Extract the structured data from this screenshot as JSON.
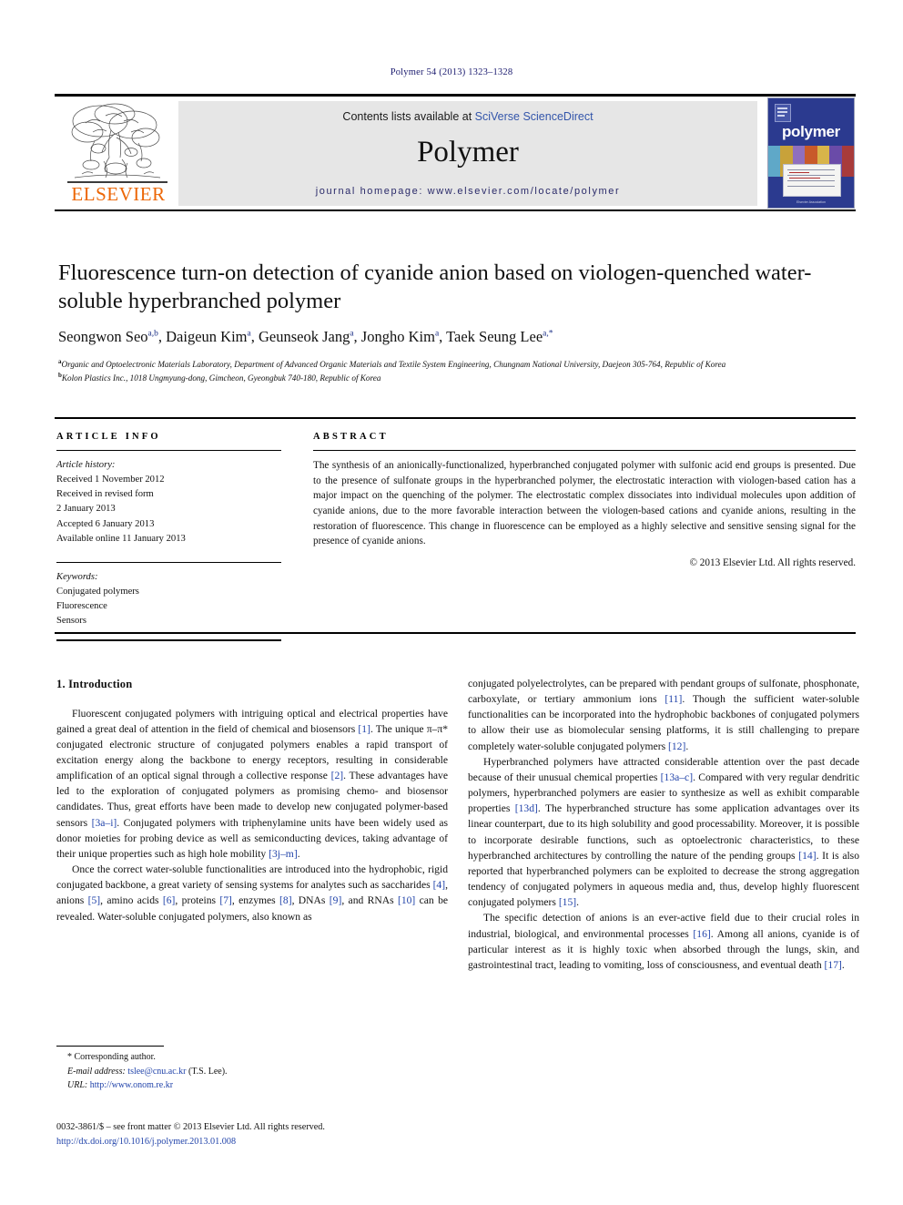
{
  "running_head": "Polymer 54 (2013) 1323–1328",
  "masthead": {
    "contents_prefix": "Contents lists available at ",
    "contents_link": "SciVerse ScienceDirect",
    "journal_name": "Polymer",
    "homepage": "journal homepage: www.elsevier.com/locate/polymer",
    "publisher_logo_text": "ELSEVIER",
    "cover_title": "polymer",
    "cover_footer": "Elsevier Association"
  },
  "article": {
    "title": "Fluorescence turn-on detection of cyanide anion based on viologen-quenched water-soluble hyperbranched polymer",
    "authors_html": "Seongwon Seo<sup>a,b</sup>, Daigeun Kim<sup>a</sup>, Geunseok Jang<sup>a</sup>, Jongho Kim<sup>a</sup>, Taek Seung Lee<sup>a,*</sup>",
    "affiliation_a": "Organic and Optoelectronic Materials Laboratory, Department of Advanced Organic Materials and Textile System Engineering, Chungnam National University, Daejeon 305-764, Republic of Korea",
    "affiliation_b": "Kolon Plastics Inc., 1018 Ungmyung-dong, Gimcheon, Gyeongbuk 740-180, Republic of Korea"
  },
  "article_info": {
    "heading": "ARTICLE INFO",
    "history_label": "Article history:",
    "history": [
      "Received 1 November 2012",
      "Received in revised form",
      "2 January 2013",
      "Accepted 6 January 2013",
      "Available online 11 January 2013"
    ],
    "keywords_label": "Keywords:",
    "keywords": [
      "Conjugated polymers",
      "Fluorescence",
      "Sensors"
    ]
  },
  "abstract": {
    "heading": "ABSTRACT",
    "text": "The synthesis of an anionically-functionalized, hyperbranched conjugated polymer with sulfonic acid end groups is presented. Due to the presence of sulfonate groups in the hyperbranched polymer, the electrostatic interaction with viologen-based cation has a major impact on the quenching of the polymer. The electrostatic complex dissociates into individual molecules upon addition of cyanide anions, due to the more favorable interaction between the viologen-based cations and cyanide anions, resulting in the restoration of fluorescence. This change in fluorescence can be employed as a highly selective and sensitive sensing signal for the presence of cyanide anions.",
    "copyright": "© 2013 Elsevier Ltd. All rights reserved."
  },
  "body": {
    "section_heading": "1. Introduction",
    "left_paragraphs_html": [
      "Fluorescent conjugated polymers with intriguing optical and electrical properties have gained a great deal of attention in the field of chemical and biosensors <span class=\"ref\">[1]</span>. The unique π&ndash;π* conjugated electronic structure of conjugated polymers enables a rapid transport of excitation energy along the backbone to energy receptors, resulting in considerable amplification of an optical signal through a collective response <span class=\"ref\">[2]</span>. These advantages have led to the exploration of conjugated polymers as promising chemo- and biosensor candidates. Thus, great efforts have been made to develop new conjugated polymer-based sensors <span class=\"ref\">[3a&ndash;i]</span>. Conjugated polymers with triphenylamine units have been widely used as donor moieties for probing device as well as semiconducting devices, taking advantage of their unique properties such as high hole mobility <span class=\"ref\">[3j&ndash;m]</span>.",
      "Once the correct water-soluble functionalities are introduced into the hydrophobic, rigid conjugated backbone, a great variety of sensing systems for analytes such as saccharides <span class=\"ref\">[4]</span>, anions <span class=\"ref\">[5]</span>, amino acids <span class=\"ref\">[6]</span>, proteins <span class=\"ref\">[7]</span>, enzymes <span class=\"ref\">[8]</span>, DNAs <span class=\"ref\">[9]</span>, and RNAs <span class=\"ref\">[10]</span> can be revealed. Water-soluble conjugated polymers, also known as"
    ],
    "right_paragraphs_html": [
      "conjugated polyelectrolytes, can be prepared with pendant groups of sulfonate, phosphonate, carboxylate, or tertiary ammonium ions <span class=\"ref\">[11]</span>. Though the sufficient water-soluble functionalities can be incorporated into the hydrophobic backbones of conjugated polymers to allow their use as biomolecular sensing platforms, it is still challenging to prepare completely water-soluble conjugated polymers <span class=\"ref\">[12]</span>.",
      "Hyperbranched polymers have attracted considerable attention over the past decade because of their unusual chemical properties <span class=\"ref\">[13a&ndash;c]</span>. Compared with very regular dendritic polymers, hyperbranched polymers are easier to synthesize as well as exhibit comparable properties <span class=\"ref\">[13d]</span>. The hyperbranched structure has some application advantages over its linear counterpart, due to its high solubility and good processability. Moreover, it is possible to incorporate desirable functions, such as optoelectronic characteristics, to these hyperbranched architectures by controlling the nature of the pending groups <span class=\"ref\">[14]</span>. It is also reported that hyperbranched polymers can be exploited to decrease the strong aggregation tendency of conjugated polymers in aqueous media and, thus, develop highly fluorescent conjugated polymers <span class=\"ref\">[15]</span>.",
      "The specific detection of anions is an ever-active field due to their crucial roles in industrial, biological, and environmental processes <span class=\"ref\">[16]</span>. Among all anions, cyanide is of particular interest as it is highly toxic when absorbed through the lungs, skin, and gastrointestinal tract, leading to vomiting, loss of consciousness, and eventual death <span class=\"ref\">[17]</span>."
    ]
  },
  "footnotes": {
    "corresponding_author": "* Corresponding author.",
    "email_label": "E-mail address:",
    "email": "tslee@cnu.ac.kr",
    "email_suffix": "(T.S. Lee).",
    "url_label": "URL:",
    "url": "http://www.onom.re.kr",
    "imprint": "0032-3861/$ – see front matter © 2013 Elsevier Ltd. All rights reserved.",
    "doi": "http://dx.doi.org/10.1016/j.polymer.2013.01.008"
  }
}
